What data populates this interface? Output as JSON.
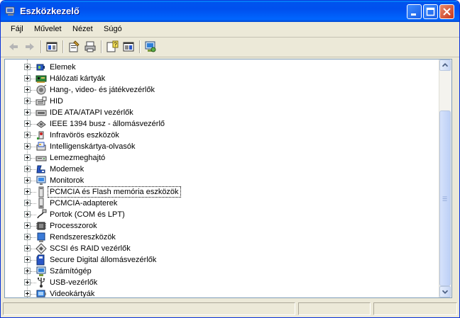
{
  "window": {
    "title": "Eszközkezelő",
    "accent": "#0054e3"
  },
  "menu": [
    "Fájl",
    "Művelet",
    "Nézet",
    "Súgó"
  ],
  "toolbar": {
    "icons": [
      "back-arrow-icon",
      "forward-arrow-icon",
      "show-hide-console-tree-icon",
      "properties-icon",
      "print-icon",
      "help-icon",
      "show-hide-action-pane-icon",
      "scan-hardware-icon"
    ]
  },
  "tree": {
    "selected_index": 11,
    "items": [
      {
        "label": "Elemek",
        "icon": "battery-icon"
      },
      {
        "label": "Hálózati kártyák",
        "icon": "network-card-icon"
      },
      {
        "label": "Hang-, video- és játékvezérlők",
        "icon": "sound-icon"
      },
      {
        "label": "HID",
        "icon": "hid-icon"
      },
      {
        "label": "IDE ATA/ATAPI vezérlők",
        "icon": "ide-controller-icon"
      },
      {
        "label": "IEEE 1394 busz - állomásvezérlő",
        "icon": "ieee1394-icon"
      },
      {
        "label": "Infravörös eszközök",
        "icon": "infrared-icon"
      },
      {
        "label": "Intelligenskártya-olvasók",
        "icon": "smartcard-reader-icon"
      },
      {
        "label": "Lemezmeghajtó",
        "icon": "disk-drive-icon"
      },
      {
        "label": "Modemek",
        "icon": "modem-icon"
      },
      {
        "label": "Monitorok",
        "icon": "monitor-icon"
      },
      {
        "label": "PCMCIA és Flash memória eszközök",
        "icon": "pcmcia-flash-icon"
      },
      {
        "label": "PCMCIA-adapterek",
        "icon": "pcmcia-adapter-icon"
      },
      {
        "label": "Portok (COM és LPT)",
        "icon": "port-icon"
      },
      {
        "label": "Processzorok",
        "icon": "processor-icon"
      },
      {
        "label": "Rendszereszközök",
        "icon": "system-devices-icon"
      },
      {
        "label": "SCSI és RAID vezérlők",
        "icon": "scsi-raid-icon"
      },
      {
        "label": "Secure Digital állomásvezérlők",
        "icon": "sd-host-icon"
      },
      {
        "label": "Számítógép",
        "icon": "computer-icon"
      },
      {
        "label": "USB-vezérlők",
        "icon": "usb-icon"
      },
      {
        "label": "Videokártyák",
        "icon": "display-adapter-icon"
      }
    ]
  }
}
